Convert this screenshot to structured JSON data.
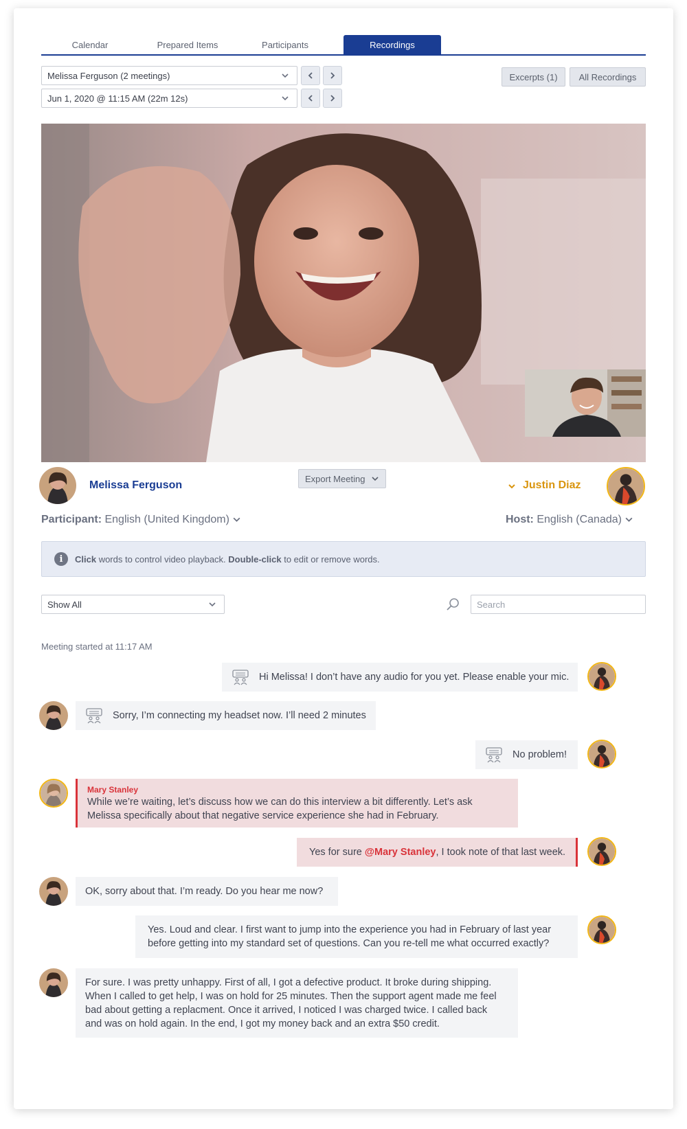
{
  "tabs": [
    {
      "label": "Calendar"
    },
    {
      "label": "Prepared Items"
    },
    {
      "label": "Participants"
    },
    {
      "label": "Recordings"
    }
  ],
  "controls": {
    "participant_select": "Melissa Ferguson (2 meetings)",
    "meeting_select": "Jun 1, 2020 @ 11:15 AM (22m 12s)",
    "excerpts_button": "Excerpts (1)",
    "all_recordings_button": "All Recordings"
  },
  "meeting": {
    "participant_name": "Melissa Ferguson",
    "host_name": "Justin Diaz",
    "export_button": "Export Meeting",
    "participant_lang_label": "Participant:",
    "participant_lang_value": "English (United Kingdom)",
    "host_lang_label": "Host:",
    "host_lang_value": "English (Canada)"
  },
  "info": {
    "click": "Click",
    "text1": " words to control video playback. ",
    "double_click": "Double-click",
    "text2": " to edit or remove words."
  },
  "filter": {
    "show_select": "Show All",
    "search_placeholder": "Search"
  },
  "transcript": {
    "started": "Meeting started at 11:17 AM",
    "messages": [
      {
        "text": "Hi Melissa! I don’t have any audio for you yet. Please enable your mic."
      },
      {
        "text": "Sorry, I’m connecting my headset now. I’ll need 2 minutes"
      },
      {
        "text": "No problem!"
      },
      {
        "author": "Mary Stanley",
        "line1": "While we’re waiting, let’s discuss how we can do this interview a bit differently. Let’s ask",
        "line2": "Melissa specifically about that negative service experience she had in February."
      },
      {
        "pre": "Yes for sure ",
        "mention": "@Mary Stanley",
        "post": ", I took note of that last week."
      },
      {
        "text": "OK, sorry about that. I’m ready. Do you hear me now?"
      },
      {
        "line1": "Yes. Loud and clear. I first want to jump into the experience you had in February of last year",
        "line2": "before getting into my standard set of questions. Can you re-tell me what occurred exactly?"
      },
      {
        "line1": "For sure. I was pretty unhappy. First of all, I got a defective product. It broke during shipping.",
        "line2": "When I called to get help, I was on hold for 25 minutes. Then the support agent made me feel",
        "line3": "bad about getting a replacment. Once it arrived, I noticed I was charged twice. I called back",
        "line4": "and was on hold again. In the end, I got my money back and an extra $50 credit."
      }
    ]
  },
  "colors": {
    "brand_blue": "#1a3d93",
    "host_gold": "#d9950f",
    "mention_red": "#d9333a"
  },
  "icons": [
    "chevron-down-icon",
    "chevron-left-icon",
    "chevron-right-icon",
    "info-icon",
    "search-icon",
    "keyboard-chat-icon"
  ]
}
